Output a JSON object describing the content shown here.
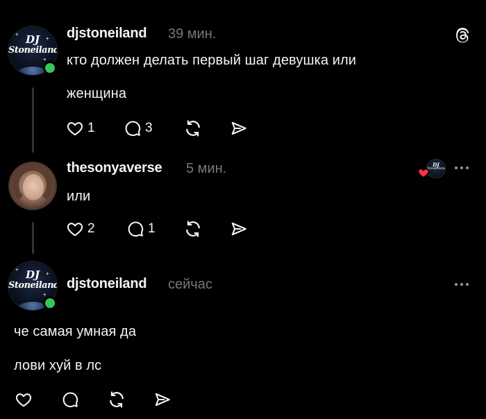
{
  "posts": [
    {
      "username": "djstoneiland",
      "time": "39 мин.",
      "text_lines": [
        "кто должен делать первый шаг девушка или",
        "женщина"
      ],
      "likes": "1",
      "replies": "3"
    },
    {
      "username": "thesonyaverse",
      "time": "5 мин.",
      "text_lines": [
        "или"
      ],
      "likes": "2",
      "replies": "1"
    },
    {
      "username": "djstoneiland",
      "time": "сейчас",
      "text_lines": [
        "че самая умная да",
        "лови хуй в лс"
      ]
    }
  ],
  "avatar_logo": {
    "line1": "DJ",
    "line2": "Stoneiland",
    "mini1": "DJ",
    "mini2": "Stoneiland"
  },
  "icons": {
    "threads": "threads-logo-icon",
    "like": "heart-icon",
    "reply": "comment-icon",
    "repost": "repost-icon",
    "share": "send-icon",
    "more": "more-icon"
  },
  "colors": {
    "background": "#000000",
    "text": "#f3f5f7",
    "muted": "#777777",
    "online": "#35c75a",
    "liked_heart": "#ff3040"
  }
}
